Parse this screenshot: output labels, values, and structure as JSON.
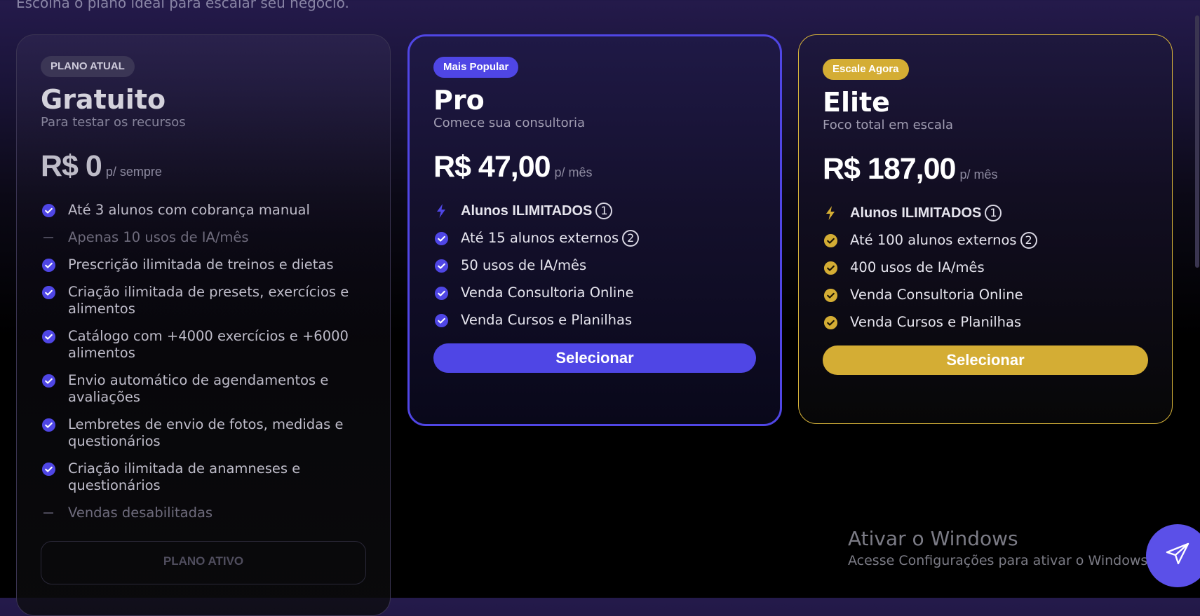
{
  "header": {
    "subtitle": "Escolha o plano ideal para escalar seu negócio."
  },
  "plans": [
    {
      "badge": "PLANO ATUAL",
      "name": "Gratuito",
      "description": "Para testar os recursos",
      "price": "R$ 0",
      "period": "p/ sempre",
      "features": [
        {
          "text": "Até 3 alunos com cobrança manual",
          "icon": "check-icon"
        },
        {
          "text": "Apenas 10 usos de IA/mês",
          "icon": "dash-icon",
          "disabled": true
        },
        {
          "text": "Prescrição ilimitada de treinos e dietas",
          "icon": "check-icon"
        },
        {
          "text": "Criação ilimitada de presets, exercícios e alimentos",
          "icon": "check-icon"
        },
        {
          "text": "Catálogo com +4000 exercícios e +6000 alimentos",
          "icon": "check-icon"
        },
        {
          "text": "Envio automático de agendamentos e avaliações",
          "icon": "check-icon"
        },
        {
          "text": "Lembretes de envio de fotos, medidas e questionários",
          "icon": "check-icon"
        },
        {
          "text": "Criação ilimitada de anamneses e questionários",
          "icon": "check-icon"
        },
        {
          "text": "Vendas desabilitadas",
          "icon": "dash-icon",
          "disabled": true
        }
      ],
      "button": "PLANO ATIVO"
    },
    {
      "badge": "Mais Popular",
      "name": "Pro",
      "description": "Comece sua consultoria",
      "price": "R$ 47,00",
      "period": "p/ mês",
      "features": [
        {
          "text": "Alunos ILIMITADOS",
          "icon": "lightning-icon",
          "note": "1"
        },
        {
          "text": "Até 15 alunos externos",
          "icon": "check-icon",
          "note": "2"
        },
        {
          "text": "50 usos de IA/mês",
          "icon": "check-icon"
        },
        {
          "text": "Venda Consultoria Online",
          "icon": "check-icon"
        },
        {
          "text": "Venda Cursos e Planilhas",
          "icon": "check-icon"
        }
      ],
      "button": "Selecionar"
    },
    {
      "badge": "Escale Agora",
      "name": "Elite",
      "description": "Foco total em escala",
      "price": "R$ 187,00",
      "period": "p/ mês",
      "features": [
        {
          "text": "Alunos ILIMITADOS",
          "icon": "lightning-icon",
          "note": "1"
        },
        {
          "text": "Até 100 alunos externos",
          "icon": "check-icon",
          "note": "2"
        },
        {
          "text": "400 usos de IA/mês",
          "icon": "check-icon"
        },
        {
          "text": "Venda Consultoria Online",
          "icon": "check-icon"
        },
        {
          "text": "Venda Cursos e Planilhas",
          "icon": "check-icon"
        }
      ],
      "button": "Selecionar"
    }
  ],
  "watermark": {
    "title": "Ativar o Windows",
    "subtitle": "Acesse Configurações para ativar o Windows."
  },
  "fab": {
    "icon": "send-icon"
  },
  "colors": {
    "pro_accent": "#4f46e5",
    "elite_accent": "#d4ad34",
    "free_check": "#4f46e5"
  }
}
